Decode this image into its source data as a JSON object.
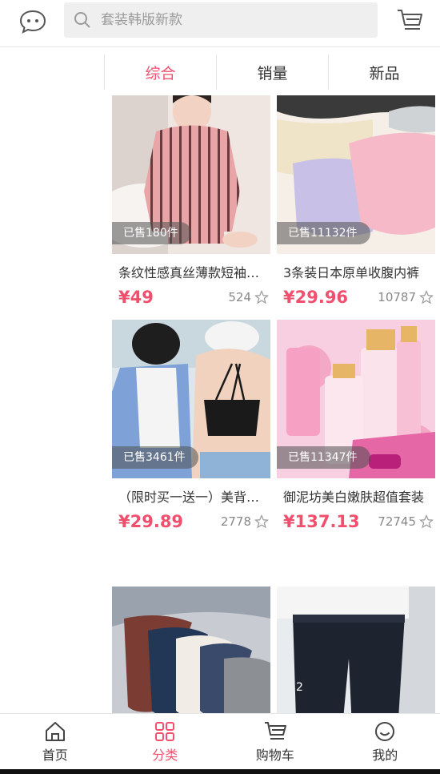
{
  "header": {
    "search_placeholder": "套装韩版新款",
    "icons": {
      "left": "chat-bubble-icon",
      "search": "search-icon",
      "right": "cart-icon"
    }
  },
  "sort": {
    "tabs": [
      {
        "label": "综合",
        "active": true
      },
      {
        "label": "销量",
        "active": false
      },
      {
        "label": "新品",
        "active": false
      }
    ]
  },
  "products": [
    {
      "sold": "已售180件",
      "title": "条纹性感真丝薄款短袖睡衣",
      "price": "¥49",
      "likes": "524"
    },
    {
      "sold": "已售11132件",
      "title": "3条装日本原单收腹内裤",
      "price": "¥29.96",
      "likes": "10787"
    },
    {
      "sold": "已售3461件",
      "title": "（限时买一送一）美背吊带",
      "price": "¥29.89",
      "likes": "2778"
    },
    {
      "sold": "已售11347件",
      "title": "御泥坊美白嫩肤超值套装",
      "price": "¥137.13",
      "likes": "72745"
    },
    {
      "sold": "",
      "title": "",
      "price": "",
      "likes": ""
    },
    {
      "sold": "",
      "title": "",
      "price": "",
      "likes": ""
    }
  ],
  "tabbar": {
    "items": [
      {
        "label": "首页",
        "icon": "home-icon",
        "active": false
      },
      {
        "label": "分类",
        "icon": "grid-icon",
        "active": true
      },
      {
        "label": "购物车",
        "icon": "cart-icon",
        "active": false
      },
      {
        "label": "我的",
        "icon": "smile-face-icon",
        "active": false
      }
    ]
  },
  "colors": {
    "accent": "#f04f6e",
    "text": "#333333",
    "muted": "#888888"
  }
}
